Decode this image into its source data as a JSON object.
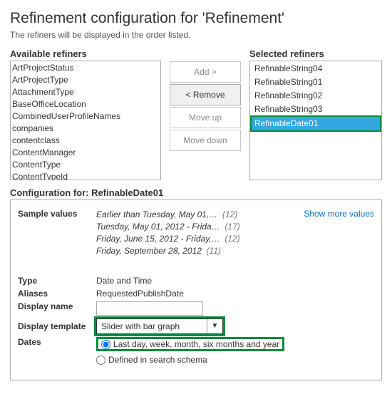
{
  "header": {
    "title": "Refinement configuration for 'Refinement'",
    "subtitle": "The refiners will be displayed in the order listed."
  },
  "available": {
    "heading": "Available refiners",
    "items": [
      "ArtProjectStatus",
      "ArtProjectType",
      "AttachmentType",
      "BaseOfficeLocation",
      "CombinedUserProfileNames",
      "companies",
      "contentclass",
      "ContentManager",
      "ContentType",
      "ContentTypeId"
    ]
  },
  "controls": {
    "add": "Add >",
    "remove": "< Remove",
    "moveup": "Move up",
    "movedown": "Move down"
  },
  "selected": {
    "heading": "Selected refiners",
    "items": [
      "RefinableString04",
      "RefinableString01",
      "RefinableString02",
      "RefinableString03"
    ],
    "highlighted": "RefinableDate01"
  },
  "config": {
    "heading": "Configuration for: RefinableDate01",
    "labels": {
      "sample": "Sample values",
      "type": "Type",
      "aliases": "Aliases",
      "display_name": "Display name",
      "display_template": "Display template",
      "dates": "Dates"
    },
    "samples": [
      {
        "text": "Earlier than Tuesday, May 01,…",
        "count": "(12)"
      },
      {
        "text": "Tuesday, May 01, 2012 - Frida…",
        "count": "(17)"
      },
      {
        "text": "Friday, June 15, 2012 - Friday,…",
        "count": "(12)"
      },
      {
        "text": "Friday, September 28, 2012",
        "count": "(11)"
      }
    ],
    "show_more": "Show more values",
    "type_value": "Date and Time",
    "aliases_value": "RequestedPublishDate",
    "display_name_value": "",
    "display_template_value": "Slider with bar graph",
    "dates_options": {
      "opt1": "Last day, week, month, six months and year",
      "opt2": "Defined in search schema"
    }
  }
}
